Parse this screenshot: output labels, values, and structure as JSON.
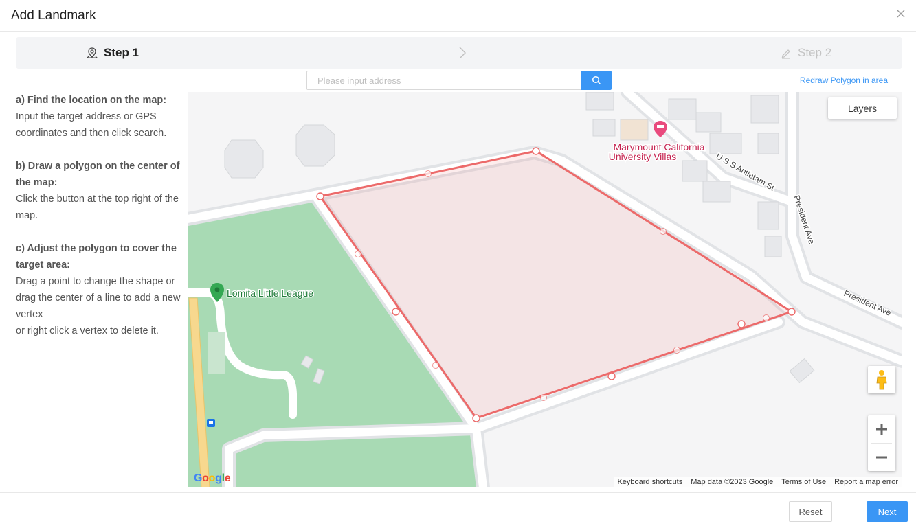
{
  "dialog": {
    "title": "Add Landmark"
  },
  "steps": [
    {
      "label": "Step 1",
      "icon": "map-pin-icon"
    },
    {
      "label": "Step 2",
      "icon": "pencil-icon"
    }
  ],
  "search": {
    "placeholder": "Please input address",
    "value": ""
  },
  "redraw_label": "Redraw Polygon in area",
  "instructions": {
    "a_heading": "a) Find the location on the map:",
    "a_body": "Input the target address or GPS coordinates and then click search.",
    "b_heading": "b) Draw a polygon on the center of the map:",
    "b_body": "Click the button at the top right of the map.",
    "c_heading": "c) Adjust the polygon to cover the target area:",
    "c_body_1": "Drag a point to change the shape or drag the center of a line to add a new vertex",
    "c_body_2": "or right click a vertex to delete it."
  },
  "map": {
    "layers_label": "Layers",
    "place_labels": {
      "villas_1": "Marymount California",
      "villas_2": "University Villas",
      "league": "Lomita Little League",
      "antietam": "U S S Antietam St",
      "president_v": "President Ave",
      "president_h": "President Ave"
    },
    "attribution": {
      "shortcuts": "Keyboard shortcuts",
      "data": "Map data ©2023 Google",
      "terms": "Terms of Use",
      "report": "Report a map error"
    },
    "logo": "Google",
    "polygon_color": "#ec6a6a"
  },
  "footer": {
    "reset_label": "Reset",
    "next_label": "Next"
  },
  "colors": {
    "accent": "#3a96f5",
    "park": "#a8dab4",
    "road": "#dadce0"
  }
}
